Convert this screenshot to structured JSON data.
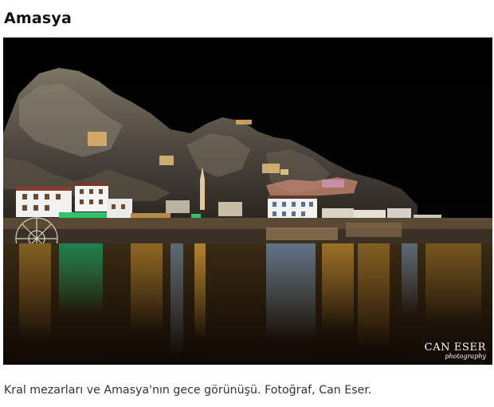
{
  "page": {
    "title": "Amasya",
    "caption": "Kral mezarları ve Amasya'nın gece görünüşü. Fotoğraf, Can Eser."
  },
  "photo": {
    "description_icon": "night-city-photo",
    "watermark": {
      "name": "CAN ESER",
      "sub": "photography"
    }
  }
}
